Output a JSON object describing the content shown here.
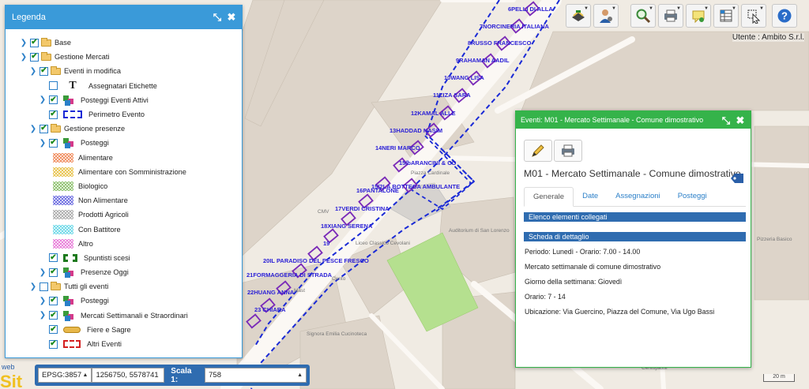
{
  "legend": {
    "title": "Legenda",
    "items": [
      {
        "label": "Base"
      },
      {
        "label": "Gestione Mercati"
      },
      {
        "label": "Eventi in modifica"
      },
      {
        "label": "Assegnatari Etichette"
      },
      {
        "label": "Posteggi Eventi Attivi"
      },
      {
        "label": "Perimetro Evento"
      },
      {
        "label": "Gestione presenze"
      },
      {
        "label": "Posteggi"
      },
      {
        "label": "Alimentare"
      },
      {
        "label": "Alimentare con Somministrazione"
      },
      {
        "label": "Biologico"
      },
      {
        "label": "Non Alimentare"
      },
      {
        "label": "Prodotti Agricoli"
      },
      {
        "label": "Con Battitore"
      },
      {
        "label": "Altro"
      },
      {
        "label": "Spuntisti scesi"
      },
      {
        "label": "Presenze Oggi"
      },
      {
        "label": "Tutti gli eventi"
      },
      {
        "label": "Posteggi"
      },
      {
        "label": "Mercati Settimanali e Straordinari"
      },
      {
        "label": "Fiere e Sagre"
      },
      {
        "label": "Altri Eventi"
      }
    ]
  },
  "toolbar": {
    "buttons": [
      "layers-icon",
      "user-settings-icon",
      "zoom-icon",
      "print-icon",
      "notes-icon",
      "table-icon",
      "select-icon",
      "help-icon"
    ]
  },
  "user": {
    "label": "Utente : Ambito S.r.l."
  },
  "event_panel": {
    "title": "Eventi: M01 - Mercato Settimanale - Comune dimostrativo",
    "heading": "M01 - Mercato Settimanale - Comune dimostrativo",
    "tabs": [
      "Generale",
      "Date",
      "Assegnazioni",
      "Posteggi"
    ],
    "section1": "Elenco elementi collegati",
    "section2": "Scheda di dettaglio",
    "details": [
      "Periodo: Lunedì -  Orario: 7.00 - 14.00",
      "Mercato settimanale di comune dimostrativo",
      "Giorno della settimana: Giovedì",
      "Orario: 7 - 14",
      "Ubicazione: Via Guercino, Piazza del Comune, Via Ugo Bassi"
    ]
  },
  "bottom": {
    "logo_top": "web",
    "logo_main": "Sit",
    "crs": "EPSG:3857",
    "coordinates": "1256750, 5578741",
    "scale_label": "Scala 1:",
    "scale_value": "758",
    "scale_marker": "20 m"
  },
  "map": {
    "stalls": [
      "6PELLI DI ALLA",
      "7NORCINERIA ITALIANA",
      "8RUSSO FRANCESCO",
      "9RAHAMAN AADIL",
      "10WANG LISA",
      "11ZIZA SARA",
      "12KAMAL ALLE",
      "13HADDAD NASIM",
      "14NERI MARCO",
      "15/bARANCINI & CO",
      "15/2LA BOTTEGA AMBULANTE",
      "16PANTALONE",
      "17VERDI CRISTINA",
      "18XIANG SERENA",
      "19",
      "20IL PARADISO DEL PESCE FRESCO",
      "21FORMAGGERIA DI STRADA",
      "22HUANG ANNA",
      "23 CHIARA"
    ],
    "places": [
      "Piazza Cardinale",
      "Auditorium di San Lorenzo",
      "Liceo Classico Cevolani",
      "Signora Emilia Cucinoteca",
      "Pizzeria Basico",
      "Centopassi",
      "Cento",
      "CMV",
      "Mast"
    ]
  }
}
